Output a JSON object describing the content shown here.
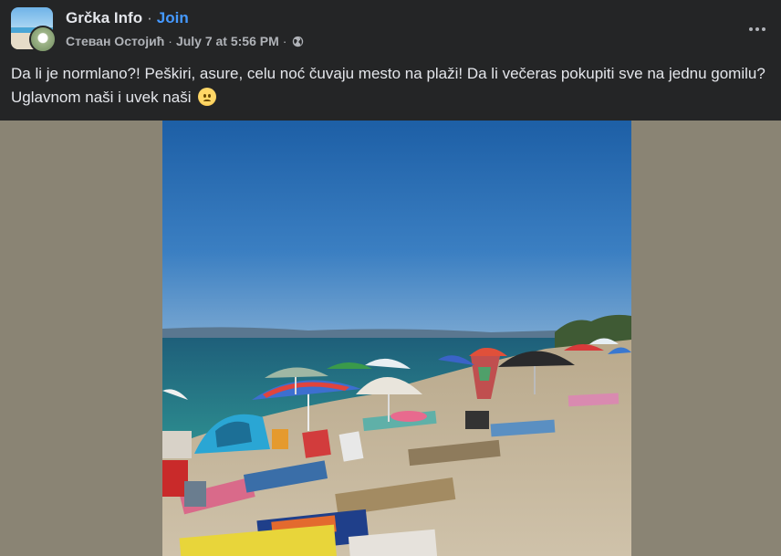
{
  "header": {
    "group_name": "Grčka Info",
    "separator": "·",
    "join_label": "Join",
    "author": "Стеван Остојић",
    "meta_separator": "·",
    "timestamp": "July 7 at 5:56 PM",
    "privacy_icon": "globe-icon",
    "more_icon": "more-horizontal-icon"
  },
  "post": {
    "text": "Da li je normlano?! Peškiri, asure, celu noć čuvaju mesto na plaži! Da li večeras pokupiti sve na jednu gomilu? Uglavnom naši i uvek naši",
    "emoji": "worried-face-emoji"
  },
  "colors": {
    "background": "#242526",
    "text_primary": "#e4e6eb",
    "text_secondary": "#b0b3b8",
    "link": "#4599ff",
    "media_letterbox": "#8a8474"
  }
}
